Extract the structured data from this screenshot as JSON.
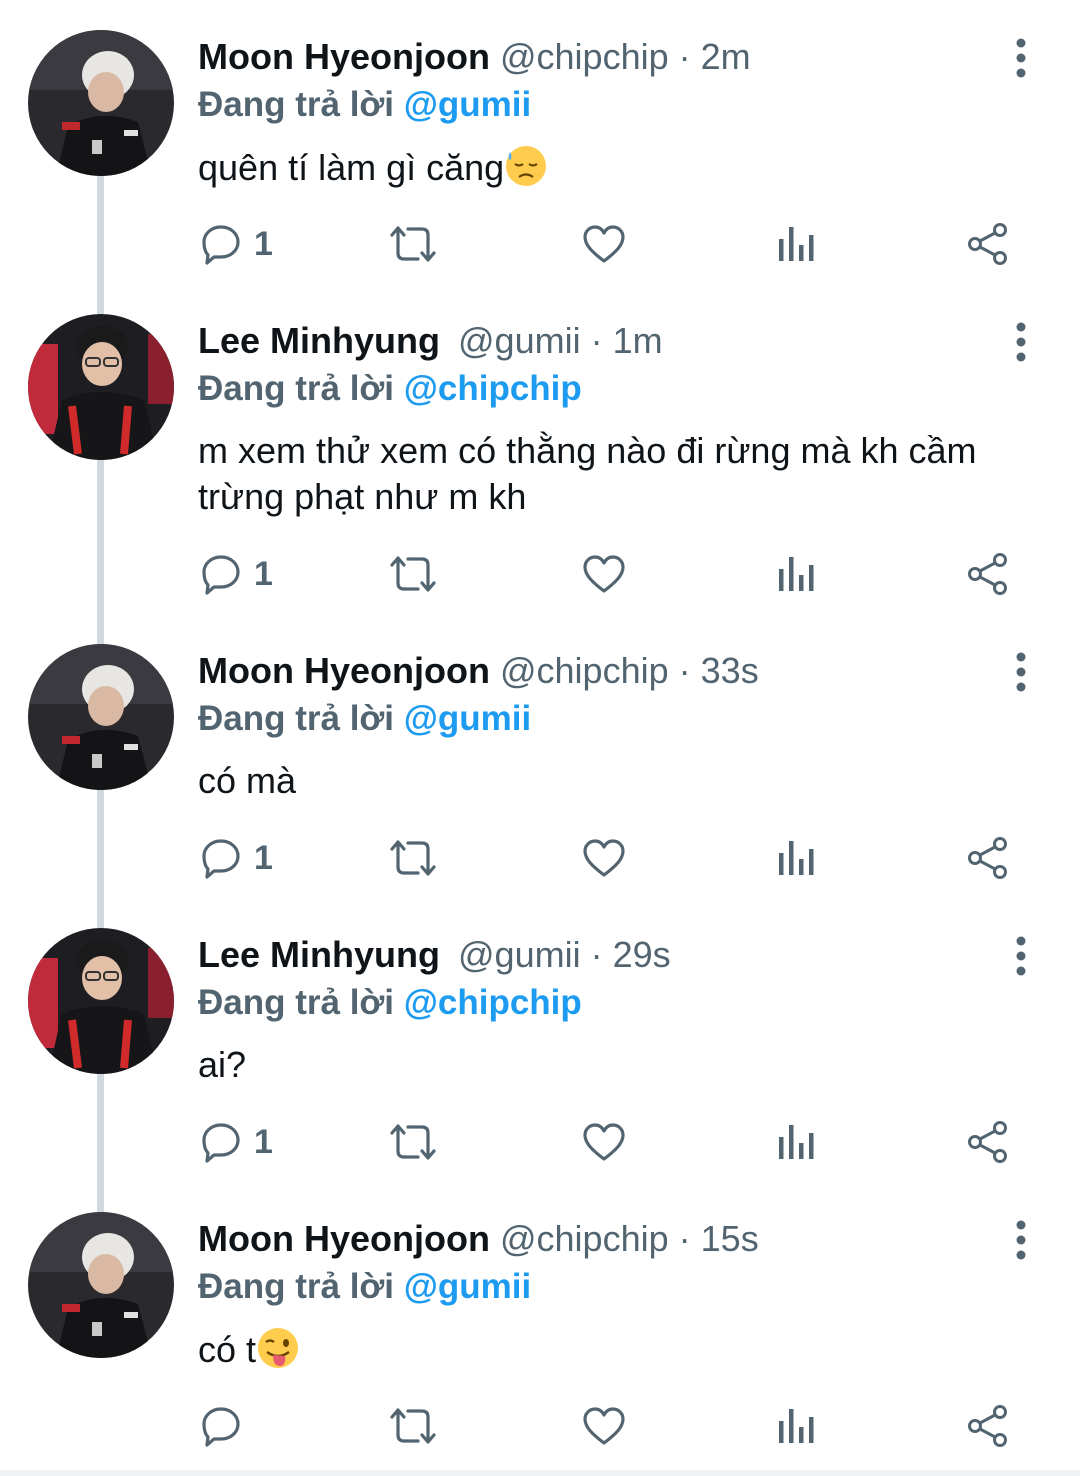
{
  "tweets": [
    {
      "name": "Moon Hyeonjoon",
      "handle": "@chipchip",
      "time": "2m",
      "reply_prefix": "Đang trả lời",
      "reply_to": "@gumii",
      "text": "quên tí làm gì căng",
      "emoji": "downcast-sweat-face",
      "reply_count": "1",
      "avatar": "moon-avatar"
    },
    {
      "name": "Lee Minhyung",
      "handle": "@gumii",
      "time": "1m",
      "reply_prefix": "Đang trả lời",
      "reply_to": "@chipchip",
      "text": "m xem thử xem có thằng nào đi rừng mà kh cầm trừng phạt như m kh",
      "reply_count": "1",
      "avatar": "lee-avatar"
    },
    {
      "name": "Moon Hyeonjoon",
      "handle": "@chipchip",
      "time": "33s",
      "reply_prefix": "Đang trả lời",
      "reply_to": "@gumii",
      "text": "có mà",
      "reply_count": "1",
      "avatar": "moon-avatar"
    },
    {
      "name": "Lee Minhyung",
      "handle": "@gumii",
      "time": "29s",
      "reply_prefix": "Đang trả lời",
      "reply_to": "@chipchip",
      "text": "ai?",
      "reply_count": "1",
      "avatar": "lee-avatar"
    },
    {
      "name": "Moon Hyeonjoon",
      "handle": "@chipchip",
      "time": "15s",
      "reply_prefix": "Đang trả lời",
      "reply_to": "@gumii",
      "text": "có t",
      "emoji": "winking-tongue-face",
      "reply_count": "",
      "avatar": "moon-avatar"
    }
  ],
  "icons": {
    "reply": "reply-icon",
    "retweet": "retweet-icon",
    "like": "heart-icon",
    "views": "views-icon",
    "share": "share-icon",
    "more": "more-vertical-icon"
  },
  "colors": {
    "text": "#0f1419",
    "secondary": "#536471",
    "mention": "#1d9bf0",
    "thread_line": "#cfd9de"
  }
}
